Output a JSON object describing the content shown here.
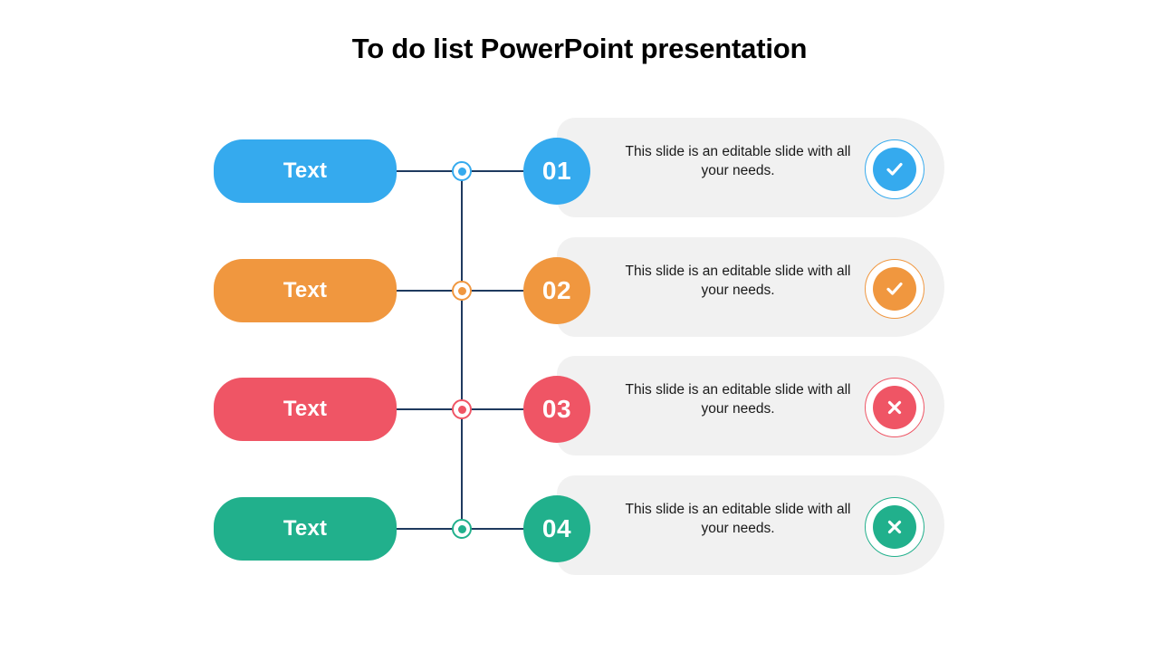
{
  "slide": {
    "title": "To do list PowerPoint presentation",
    "background": "#FFFFFF",
    "connector_color": "#1F3A5F"
  },
  "rows": [
    {
      "pill_label": "Text",
      "number": "01",
      "description": "This slide is an editable slide with all your needs.",
      "status_icon": "check-circle-icon",
      "color": "#35AAEE",
      "panel_color": "#F1F1F1"
    },
    {
      "pill_label": "Text",
      "number": "02",
      "description": "This slide is an editable slide with all your needs.",
      "status_icon": "check-circle-icon",
      "color": "#F0973F",
      "panel_color": "#F1F1F1"
    },
    {
      "pill_label": "Text",
      "number": "03",
      "description": "This slide is an editable slide with all your needs.",
      "status_icon": "x-circle-icon",
      "color": "#EF5565",
      "panel_color": "#F1F1F1"
    },
    {
      "pill_label": "Text",
      "number": "04",
      "description": "This slide is an editable slide with all your needs.",
      "status_icon": "x-circle-icon",
      "color": "#21B08C",
      "panel_color": "#F1F1F1"
    }
  ]
}
